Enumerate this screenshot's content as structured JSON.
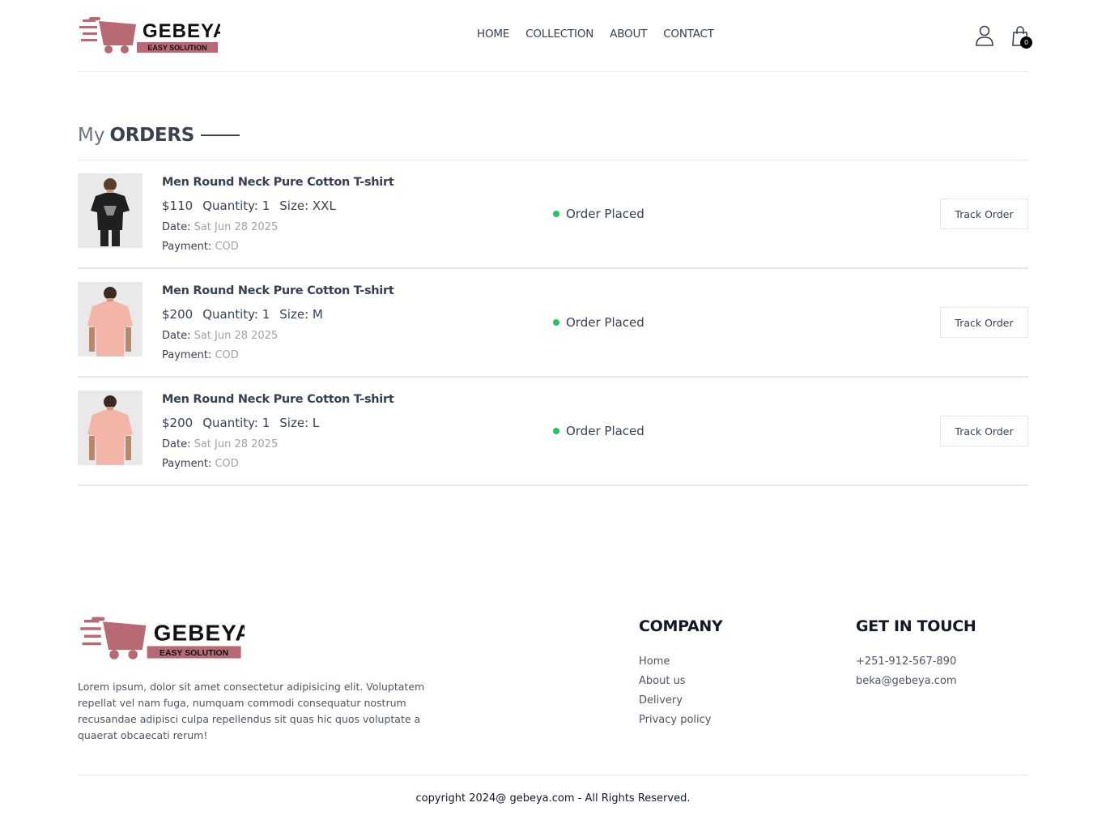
{
  "brand": {
    "name": "GEBEYA",
    "tagline": "EASY SOLUTION",
    "accent_color": "#b86a74"
  },
  "nav": {
    "items": [
      "HOME",
      "COLLECTION",
      "ABOUT",
      "CONTACT"
    ],
    "cart_count": "0",
    "icons": [
      "profile-icon",
      "shopping-bag-icon"
    ]
  },
  "page": {
    "title_light": "My",
    "title_bold": "ORDERS"
  },
  "orders": [
    {
      "name": "Men Round Neck Pure Cotton T-shirt",
      "price": "$110",
      "quantity": "Quantity: 1",
      "size": "Size: XXL",
      "date_label": "Date:",
      "date": "Sat Jun 28 2025",
      "payment_label": "Payment:",
      "payment": "COD",
      "status": "Order Placed",
      "action": "Track Order",
      "shirt_color": "#1f1f1f"
    },
    {
      "name": "Men Round Neck Pure Cotton T-shirt",
      "price": "$200",
      "quantity": "Quantity: 1",
      "size": "Size: M",
      "date_label": "Date:",
      "date": "Sat Jun 28 2025",
      "payment_label": "Payment:",
      "payment": "COD",
      "status": "Order Placed",
      "action": "Track Order",
      "shirt_color": "#f2b5a8"
    },
    {
      "name": "Men Round Neck Pure Cotton T-shirt",
      "price": "$200",
      "quantity": "Quantity: 1",
      "size": "Size: L",
      "date_label": "Date:",
      "date": "Sat Jun 28 2025",
      "payment_label": "Payment:",
      "payment": "COD",
      "status": "Order Placed",
      "action": "Track Order",
      "shirt_color": "#f2b5a8"
    }
  ],
  "footer": {
    "description": "Lorem ipsum, dolor sit amet consectetur adipisicing elit. Voluptatem repellat vel nam fuga, numquam commodi consequatur nostrum recusandae adipisci culpa repellendus sit quas hic quos voluptate a quaerat obcaecati rerum!",
    "company_title": "COMPANY",
    "company_links": [
      "Home",
      "About us",
      "Delivery",
      "Privacy policy"
    ],
    "contact_title": "GET IN TOUCH",
    "contact_items": [
      "+251-912-567-890",
      "beka@gebeya.com"
    ],
    "copyright": "copyright 2024@ gebeya.com - All Rights Reserved."
  }
}
